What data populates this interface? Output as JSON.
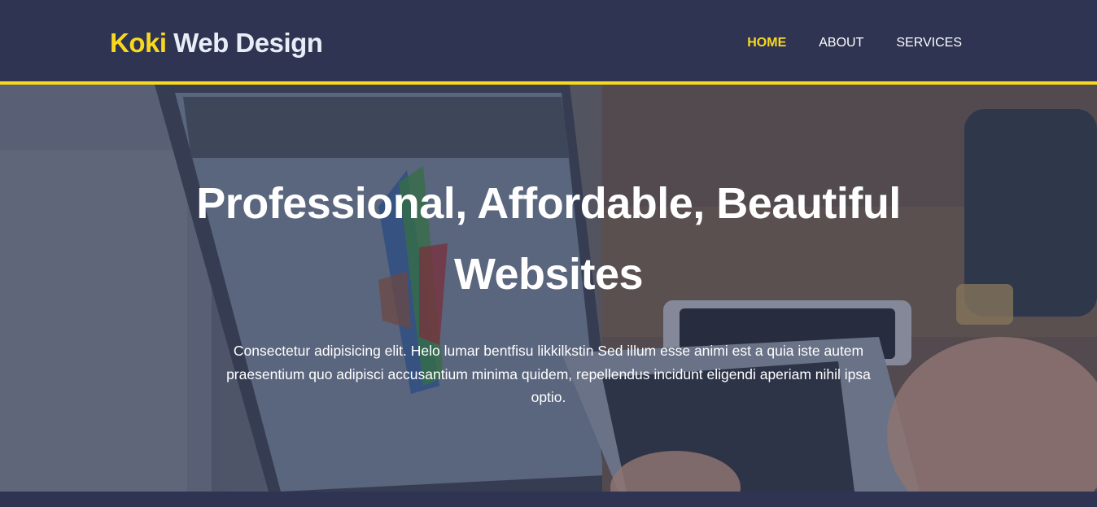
{
  "brand": {
    "accent": "Koki",
    "rest": " Web Design"
  },
  "nav": {
    "items": [
      {
        "label": "HOME"
      },
      {
        "label": "ABOUT"
      },
      {
        "label": "SERVICES"
      }
    ]
  },
  "hero": {
    "title": "Professional, Affordable, Beautiful Websites",
    "text": "Consectetur adipisicing elit. Helo lumar bentfisu likkilkstin Sed illum esse animi est a quia iste autem praesentium quo adipisci accusantium minima quidem, repellendus incidunt eligendi aperiam nihil ipsa optio."
  },
  "colors": {
    "header_bg": "#2f3452",
    "accent": "#f9d91e",
    "text": "#ffffff"
  }
}
